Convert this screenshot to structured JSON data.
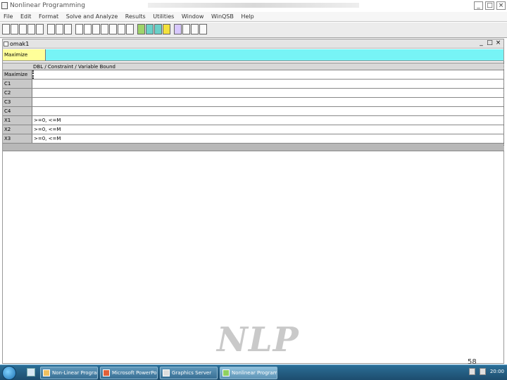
{
  "app": {
    "title": "Nonlinear Programming"
  },
  "menu": [
    "File",
    "Edit",
    "Format",
    "Solve and Analyze",
    "Results",
    "Utilities",
    "Window",
    "WinQSB",
    "Help"
  ],
  "child": {
    "title": "omak1"
  },
  "objective": {
    "label": "Maximize"
  },
  "grid": {
    "header": "DBL / Constraint / Variable Bound",
    "rows": [
      {
        "label": "Maximize",
        "value": ""
      },
      {
        "label": "C1",
        "value": ""
      },
      {
        "label": "C2",
        "value": ""
      },
      {
        "label": "C3",
        "value": ""
      },
      {
        "label": "C4",
        "value": ""
      },
      {
        "label": "X1",
        "value": ">=0, <=M"
      },
      {
        "label": "X2",
        "value": ">=0, <=M"
      },
      {
        "label": "X3",
        "value": ">=0, <=M"
      }
    ]
  },
  "slide": {
    "watermark": "NLP",
    "page_number": "58"
  },
  "taskbar": {
    "tasks": [
      "Non-Linear Program...",
      "Microsoft PowerPoin...",
      "Graphics Server",
      "Nonlinear Program..."
    ],
    "clock": "20:00"
  }
}
